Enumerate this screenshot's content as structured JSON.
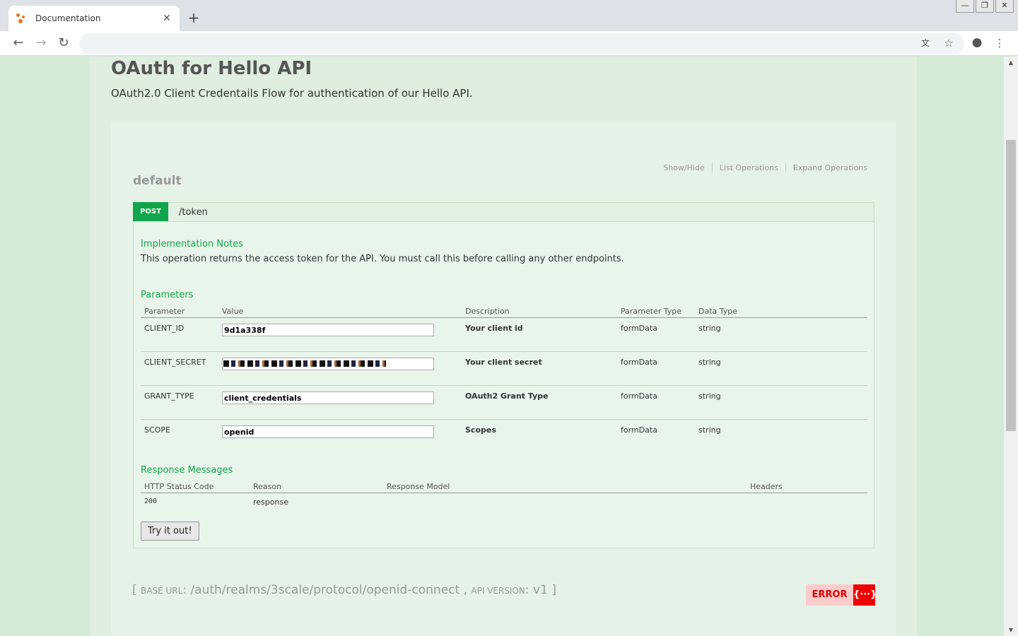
{
  "browser": {
    "tab_title": "Documentation",
    "close_symbol": "✕",
    "new_tab_symbol": "+",
    "window_buttons": [
      "—",
      "❐",
      "✕"
    ]
  },
  "page": {
    "title": "OAuth for Hello API",
    "subtitle": "OAuth2.0 Client Credentails Flow for authentication of our Hello API."
  },
  "resource": {
    "name": "default",
    "links": [
      "Show/Hide",
      "List Operations",
      "Expand Operations"
    ]
  },
  "operation": {
    "method": "POST",
    "path": "/token",
    "notes_title": "Implementation Notes",
    "notes": "This operation returns the access token for the API. You must call this before calling any other endpoints.",
    "params_title": "Parameters",
    "param_headers": [
      "Parameter",
      "Value",
      "Description",
      "Parameter Type",
      "Data Type"
    ],
    "params": [
      {
        "name": "CLIENT_ID",
        "value": "9d1a338f",
        "desc": "Your client id",
        "ptype": "formData",
        "dtype": "string"
      },
      {
        "name": "CLIENT_SECRET",
        "value": "",
        "desc": "Your client secret",
        "ptype": "formData",
        "dtype": "string"
      },
      {
        "name": "GRANT_TYPE",
        "value": "client_credentials",
        "desc": "OAuth2 Grant Type",
        "ptype": "formData",
        "dtype": "string"
      },
      {
        "name": "SCOPE",
        "value": "openid",
        "desc": "Scopes",
        "ptype": "formData",
        "dtype": "string"
      }
    ],
    "resp_title": "Response Messages",
    "resp_headers": [
      "HTTP Status Code",
      "Reason",
      "Response Model",
      "Headers"
    ],
    "responses": [
      {
        "code": "200",
        "reason": "response"
      }
    ],
    "try_label": "Try it out!"
  },
  "footer": {
    "base_url_label": "BASE URL",
    "base_url": "/auth/realms/3scale/protocol/openid-connect",
    "api_version_label": "API VERSION",
    "api_version": "v1",
    "error_label": "ERROR",
    "error_icon": "{···}"
  }
}
